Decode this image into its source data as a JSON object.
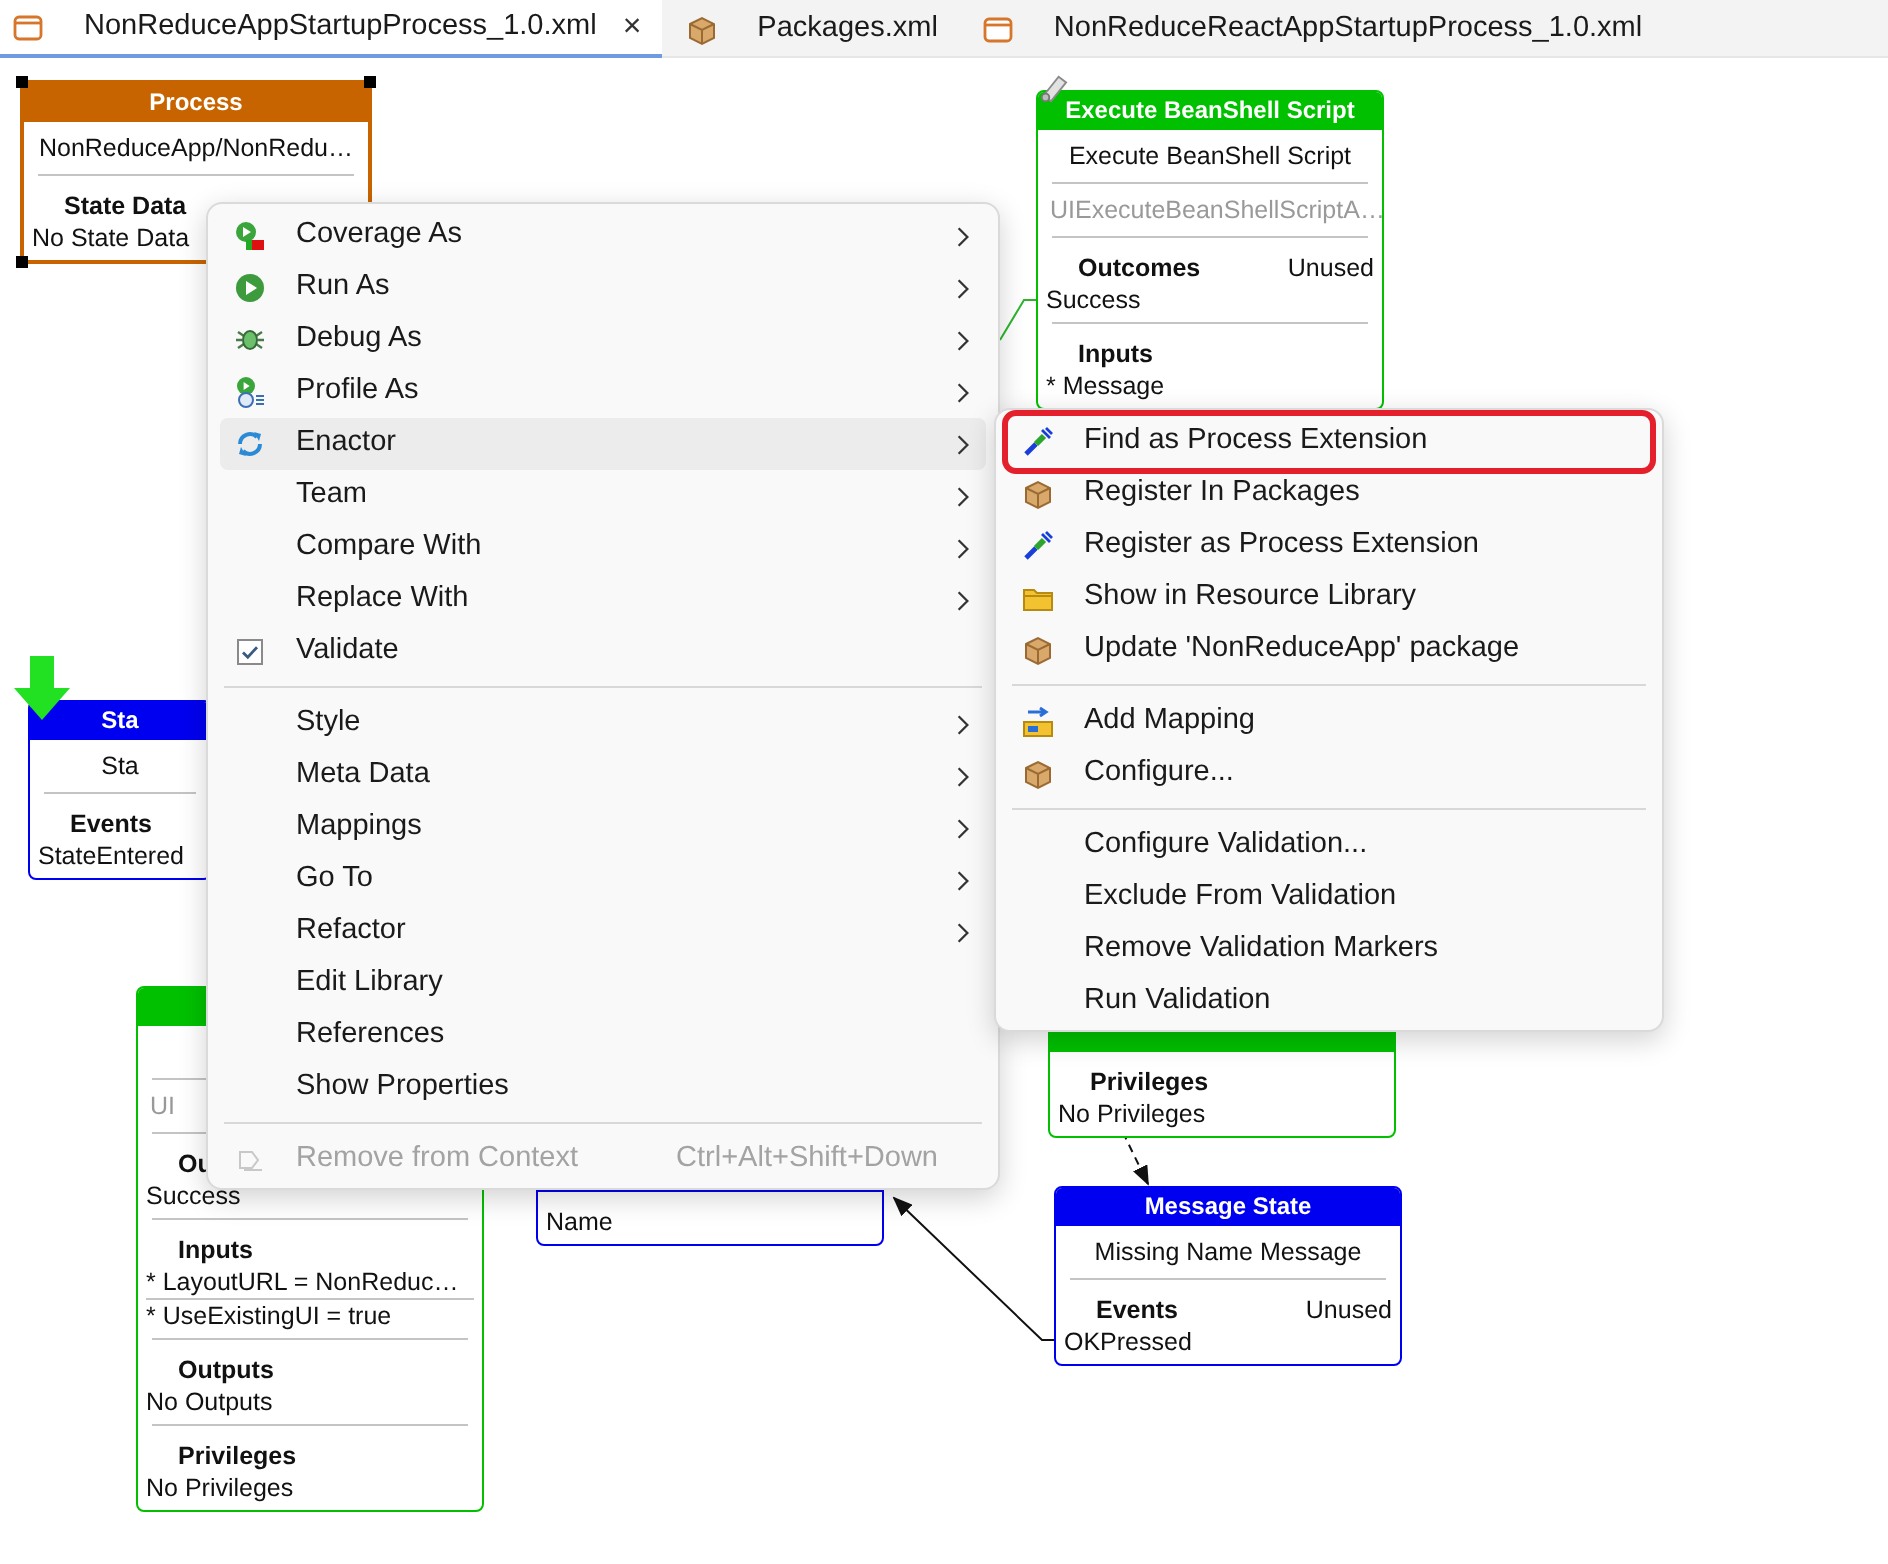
{
  "tabs": [
    {
      "label": "NonReduceAppStartupProcess_1.0.xml",
      "selected": true,
      "close": "×"
    },
    {
      "label": "Packages.xml",
      "selected": false
    },
    {
      "label": "NonReduceReactAppStartupProcess_1.0.xml",
      "selected": false
    }
  ],
  "diagram": {
    "nodes": [
      {
        "kind": "process",
        "selected": true,
        "title": "Process",
        "name": "NonReduceApp/NonRedu…",
        "sections": [
          {
            "heading": "State Data",
            "items": [
              "No State Data"
            ]
          }
        ]
      },
      {
        "kind": "action",
        "selected": false,
        "title": "Execute BeanShell Script",
        "name": "Execute BeanShell Script",
        "ref": "UIExecuteBeanShellScriptA…",
        "sections": [
          {
            "heading": "Outcomes",
            "status": "Unused",
            "items": [
              "Success"
            ]
          },
          {
            "heading": "Inputs",
            "items": [
              "* Message"
            ]
          }
        ]
      },
      {
        "kind": "action",
        "selected": false,
        "sections": [
          {
            "heading": "Privileges",
            "items": [
              "No Privileges"
            ]
          }
        ]
      },
      {
        "kind": "state",
        "selected": false,
        "start": true,
        "title": "Sta",
        "name": "Sta",
        "sections": [
          {
            "heading": "Events",
            "items": [
              "StateEntered"
            ]
          }
        ]
      },
      {
        "kind": "action",
        "selected": false,
        "ref": "UI",
        "sections": [
          {
            "heading": "Ou",
            "items": [
              "Success"
            ]
          },
          {
            "heading": "Inputs",
            "items": [
              "* LayoutURL = NonReduc…",
              "* UseExistingUI = true"
            ]
          },
          {
            "heading": "Outputs",
            "items": [
              "No Outputs"
            ]
          },
          {
            "heading": "Privileges",
            "items": [
              "No Privileges"
            ]
          }
        ]
      },
      {
        "kind": "state",
        "selected": false,
        "sections": [
          {
            "items": [
              "Name"
            ]
          }
        ]
      },
      {
        "kind": "state",
        "selected": false,
        "title": "Message State",
        "name": "Missing Name Message",
        "sections": [
          {
            "heading": "Events",
            "status": "Unused",
            "items": [
              "OKPressed"
            ]
          }
        ]
      }
    ],
    "connectors": [
      {
        "kind": "green-line"
      },
      {
        "kind": "dashed-arrow"
      },
      {
        "kind": "arrow"
      }
    ]
  },
  "context_menu": {
    "groups": [
      [
        {
          "label": "Coverage As",
          "has_submenu": true,
          "disabled": false,
          "highlighted": false
        },
        {
          "label": "Run As",
          "has_submenu": true,
          "disabled": false,
          "highlighted": false
        },
        {
          "label": "Debug As",
          "has_submenu": true,
          "disabled": false,
          "highlighted": false
        },
        {
          "label": "Profile As",
          "has_submenu": true,
          "disabled": false,
          "highlighted": false
        },
        {
          "label": "Enactor",
          "has_submenu": true,
          "disabled": false,
          "highlighted": true
        },
        {
          "label": "Team",
          "has_submenu": true,
          "disabled": false,
          "highlighted": false
        },
        {
          "label": "Compare With",
          "has_submenu": true,
          "disabled": false,
          "highlighted": false
        },
        {
          "label": "Replace With",
          "has_submenu": true,
          "disabled": false,
          "highlighted": false
        },
        {
          "label": "Validate",
          "checked": true,
          "has_submenu": false,
          "disabled": false,
          "highlighted": false
        }
      ],
      [
        {
          "label": "Style",
          "has_submenu": true,
          "disabled": false,
          "highlighted": false
        },
        {
          "label": "Meta Data",
          "has_submenu": true,
          "disabled": false,
          "highlighted": false
        },
        {
          "label": "Mappings",
          "has_submenu": true,
          "disabled": false,
          "highlighted": false
        },
        {
          "label": "Go To",
          "has_submenu": true,
          "disabled": false,
          "highlighted": false
        },
        {
          "label": "Refactor",
          "has_submenu": true,
          "disabled": false,
          "highlighted": false
        },
        {
          "label": "Edit Library",
          "has_submenu": false,
          "disabled": false,
          "highlighted": false
        },
        {
          "label": "References",
          "has_submenu": false,
          "disabled": false,
          "highlighted": false
        },
        {
          "label": "Show Properties",
          "has_submenu": false,
          "disabled": false,
          "highlighted": false
        }
      ],
      [
        {
          "label": "Remove from Context",
          "shortcut": "Ctrl+Alt+Shift+Down",
          "has_submenu": false,
          "disabled": true,
          "highlighted": false
        }
      ]
    ]
  },
  "enactor_submenu": {
    "groups": [
      [
        {
          "label": "Find as Process Extension",
          "marked": true
        },
        {
          "label": "Register In Packages",
          "marked": false
        },
        {
          "label": "Register as Process Extension",
          "marked": false
        },
        {
          "label": "Show in Resource Library",
          "marked": false
        },
        {
          "label": "Update 'NonReduceApp' package",
          "marked": false
        }
      ],
      [
        {
          "label": "Add Mapping",
          "marked": false
        },
        {
          "label": "Configure...",
          "marked": false
        }
      ],
      [
        {
          "label": "Configure Validation...",
          "marked": false
        },
        {
          "label": "Exclude From Validation",
          "marked": false
        },
        {
          "label": "Remove Validation Markers",
          "marked": false
        },
        {
          "label": "Run Validation",
          "marked": false
        }
      ]
    ]
  }
}
